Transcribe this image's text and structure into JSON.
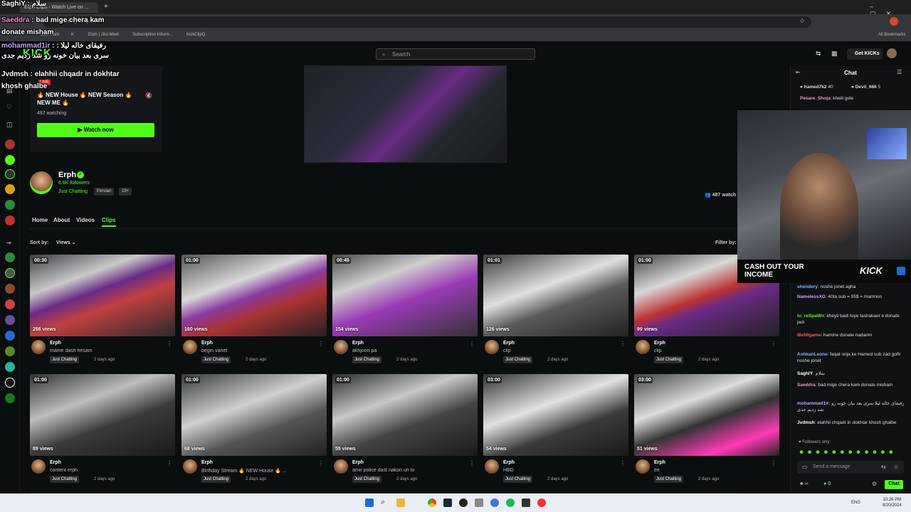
{
  "browser": {
    "tab_title": "Erph Clips - Watch Live on ...",
    "url": "kick.com/erph/clips",
    "bookmarks": [
      "Coin mark",
      "K",
      "Erph | Jitsi Meet",
      "Subscription Inform...",
      "KickClipQ"
    ],
    "all_bookmarks": "All Bookmarks"
  },
  "overlay_chat": [
    {
      "user": "SaghiY",
      "text": "سلام"
    },
    {
      "user": "Saeddra",
      "text": "bad mige chera kam donate misham"
    },
    {
      "user": "mohammad1ir",
      "text": "رفیقای خاله لیلا : سری بعد بیان خونه رو شد زدیم جدی"
    },
    {
      "user": "Jvdmsh",
      "text": "elahhii chqadr in dokhtar khosh ghalbe"
    }
  ],
  "header": {
    "search_placeholder": "Search",
    "get_kicks": "Get KICKs"
  },
  "featured": {
    "title": "🔥 NEW House 🔥 NEW Season 🔥 NEW ME 🔥",
    "watching": "487 watching",
    "watch_now": "Watch now",
    "live": "LIVE"
  },
  "channel": {
    "name": "Erph",
    "followers": "6.6K followers",
    "category": "Just Chatting",
    "tags": [
      "Persian",
      "18+"
    ],
    "viewers": "487 watch"
  },
  "nav": {
    "tabs": [
      "Home",
      "About",
      "Videos",
      "Clips"
    ],
    "active": "Clips",
    "sort_label": "Sort by:",
    "sort_value": "Views",
    "filter_label": "Filter by:"
  },
  "clips": [
    {
      "duration": "00:30",
      "views": "266 views",
      "streamer": "Erph",
      "title": "mame dash hesam",
      "category": "Just Chatting",
      "ago": "2 days ago"
    },
    {
      "duration": "01:00",
      "views": "160 views",
      "streamer": "Erph",
      "title": "begin vanet",
      "category": "Just Chatting",
      "ago": "2 days ago"
    },
    {
      "duration": "00:45",
      "views": "154 views",
      "streamer": "Erph",
      "title": "akhjoon pa",
      "category": "Just Chatting",
      "ago": "2 days ago"
    },
    {
      "duration": "01:01",
      "views": "126 views",
      "streamer": "Erph",
      "title": "clip",
      "category": "Just Chatting",
      "ago": "2 days ago"
    },
    {
      "duration": "01:00",
      "views": "99 views",
      "streamer": "Erph",
      "title": "clip",
      "category": "Just Chatting",
      "ago": "2 days ago"
    },
    {
      "duration": "01:00",
      "views": "89 views",
      "streamer": "Erph",
      "title": "content erph",
      "category": "Just Chatting",
      "ago": "2 days ago"
    },
    {
      "duration": "01:00",
      "views": "68 views",
      "streamer": "Erph",
      "title": "Birthday Stream 🔥 NEW House 🔥 ...",
      "category": "Just Chatting",
      "ago": "2 days ago"
    },
    {
      "duration": "01:00",
      "views": "55 views",
      "streamer": "Erph",
      "title": "amir police dast nakon un to",
      "category": "Just Chatting",
      "ago": "2 days ago"
    },
    {
      "duration": "03:00",
      "views": "54 views",
      "streamer": "Erph",
      "title": "HBD",
      "category": "Just Chatting",
      "ago": "2 days ago"
    },
    {
      "duration": "03:00",
      "views": "51 views",
      "streamer": "Erph",
      "title": "ee",
      "category": "Just Chatting",
      "ago": "2 days ago"
    }
  ],
  "chat": {
    "title": "Chat",
    "top_gifters": [
      {
        "name": "hamed7k2",
        "count": "40"
      },
      {
        "name": "Devil_666",
        "count": "5"
      }
    ],
    "pinned": {
      "user": "Pesare_Shoja",
      "text": "kheili gole"
    },
    "cash_out": "CASH OUT YOUR INCOME",
    "kick_logo": "KICK",
    "messages": [
      {
        "user": "shendery",
        "text": "noshe jonet agha",
        "color": "#7fb3ff"
      },
      {
        "user": "NamelessXO",
        "text": "40ta sub = 95$ = mamnon",
        "color": "#c9a0ff"
      },
      {
        "user": "to_reSpaWn",
        "text": "kheyli badi toye tashakaor e donate jedi",
        "color": "#53fc18"
      },
      {
        "user": "i8x00game",
        "text": "hamine donate nadarim",
        "color": "#ff5a5a"
      },
      {
        "user": "AshkanLeone",
        "text": "faqat onja ke Hamed sub zad gofti noshe jonet",
        "color": "#7fb3ff"
      },
      {
        "user": "SaghiY",
        "text": "سلام",
        "color": "#ffffff"
      },
      {
        "user": "Saeddra",
        "text": "bad mige chera kam donate misham",
        "color": "#ff8ad8"
      },
      {
        "user": "mohammad1ir",
        "text": "رفیقای خاله لیلا سری بعد بیان خونه رو شد زدیم جدی",
        "color": "#c9a0ff"
      },
      {
        "user": "Jvdmsh",
        "text": "elahhii chqadr in dokhtar khosh ghalbe",
        "color": "#ffffff"
      }
    ],
    "followers_only": "Followers only",
    "send_placeholder": "Send a message",
    "kicks_count": "0",
    "chat_button": "Chat"
  },
  "taskbar": {
    "lang": "ENG",
    "time": "10:26 PM",
    "date": "8/20/2024"
  }
}
